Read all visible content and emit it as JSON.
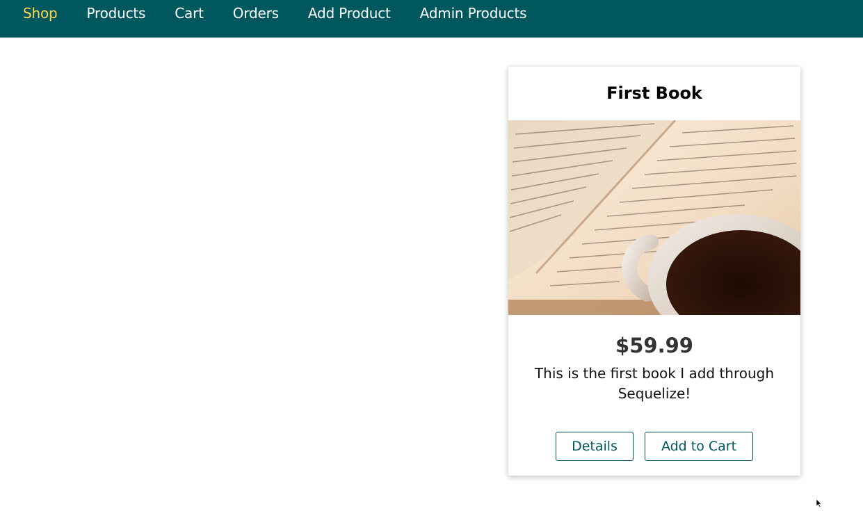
{
  "nav": {
    "items": [
      {
        "label": "Shop",
        "active": true
      },
      {
        "label": "Products",
        "active": false
      },
      {
        "label": "Cart",
        "active": false
      },
      {
        "label": "Orders",
        "active": false
      },
      {
        "label": "Add Product",
        "active": false
      },
      {
        "label": "Admin Products",
        "active": false
      }
    ]
  },
  "product": {
    "title": "First Book",
    "price": "$59.99",
    "description": "This is the first book I add through Sequelize!",
    "image_alt": "open-book-with-coffee-cup",
    "details_label": "Details",
    "add_to_cart_label": "Add to Cart"
  },
  "colors": {
    "header_bg": "#00585e",
    "active_nav": "#ffd54f",
    "nav_text": "#ffffff",
    "button_border": "#00585e"
  }
}
